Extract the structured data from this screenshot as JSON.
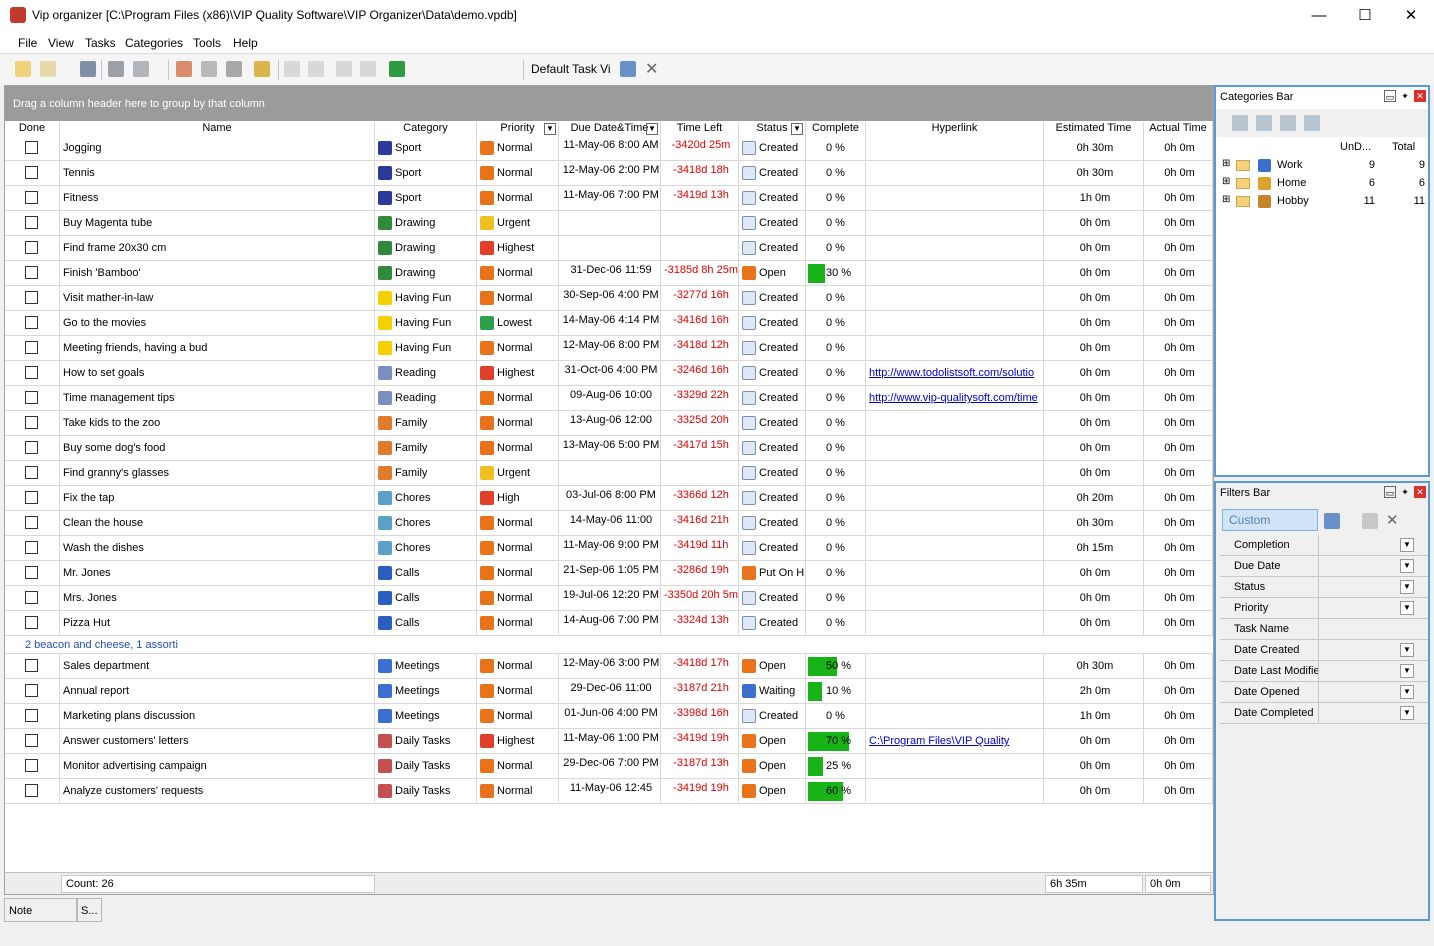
{
  "window": {
    "title": "Vip organizer [C:\\Program Files (x86)\\VIP Quality Software\\VIP Organizer\\Data\\demo.vpdb]",
    "minimize": "—",
    "maximize": "☐",
    "close": "✕"
  },
  "menu": [
    "File",
    "View",
    "Tasks",
    "Categories",
    "Tools",
    "Help"
  ],
  "toolbar": {
    "view_select": "Default Task Vi"
  },
  "grid": {
    "group_hint": "Drag a column header here to group by that column",
    "columns": [
      "Done",
      "Name",
      "Category",
      "Priority",
      "Due Date&Time",
      "Time Left",
      "Status",
      "Complete",
      "Hyperlink",
      "Estimated Time",
      "Actual Time"
    ],
    "rows": [
      {
        "name": "Jogging",
        "category": "Sport",
        "cat_icon": "flag-icon",
        "priority": "Normal",
        "pri_icon": "normal-icon",
        "due": "11-May-06 8:00 AM",
        "left": "-3420d 25m",
        "status": "Created",
        "st_icon": "doc-icon",
        "complete": "0 %",
        "pct": 0,
        "link": "",
        "est": "0h 30m",
        "act": "0h 0m"
      },
      {
        "name": "Tennis",
        "category": "Sport",
        "cat_icon": "flag-icon",
        "priority": "Normal",
        "pri_icon": "normal-icon",
        "due": "12-May-06 2:00 PM",
        "left": "-3418d 18h",
        "status": "Created",
        "st_icon": "doc-icon",
        "complete": "0 %",
        "pct": 0,
        "link": "",
        "est": "0h 30m",
        "act": "0h 0m"
      },
      {
        "name": "Fitness",
        "category": "Sport",
        "cat_icon": "flag-icon",
        "priority": "Normal",
        "pri_icon": "normal-icon",
        "due": "11-May-06 7:00 PM",
        "left": "-3419d 13h",
        "status": "Created",
        "st_icon": "doc-icon",
        "complete": "0 %",
        "pct": 0,
        "link": "",
        "est": "1h 0m",
        "act": "0h 0m"
      },
      {
        "name": "Buy Magenta tube",
        "category": "Drawing",
        "cat_icon": "picture-icon",
        "priority": "Urgent",
        "pri_icon": "warning-icon",
        "due": "",
        "left": "",
        "status": "Created",
        "st_icon": "doc-icon",
        "complete": "0 %",
        "pct": 0,
        "link": "",
        "est": "0h 0m",
        "act": "0h 0m"
      },
      {
        "name": "Find frame 20x30 cm",
        "category": "Drawing",
        "cat_icon": "picture-icon",
        "priority": "Highest",
        "pri_icon": "highest-icon",
        "due": "",
        "left": "",
        "status": "Created",
        "st_icon": "doc-icon",
        "complete": "0 %",
        "pct": 0,
        "link": "",
        "est": "0h 0m",
        "act": "0h 0m"
      },
      {
        "name": "Finish 'Bamboo'",
        "category": "Drawing",
        "cat_icon": "picture-icon",
        "priority": "Normal",
        "pri_icon": "normal-icon",
        "due": "31-Dec-06 11:59",
        "left": "-3185d 8h 25m",
        "status": "Open",
        "st_icon": "play-icon",
        "complete": "30 %",
        "pct": 30,
        "link": "",
        "est": "0h 0m",
        "act": "0h 0m"
      },
      {
        "name": "Visit mather-in-law",
        "category": "Having Fun",
        "cat_icon": "smiley-icon",
        "priority": "Normal",
        "pri_icon": "normal-icon",
        "due": "30-Sep-06 4:00 PM",
        "left": "-3277d 16h",
        "status": "Created",
        "st_icon": "doc-icon",
        "complete": "0 %",
        "pct": 0,
        "link": "",
        "est": "0h 0m",
        "act": "0h 0m"
      },
      {
        "name": "Go to the movies",
        "category": "Having Fun",
        "cat_icon": "smiley-icon",
        "priority": "Lowest",
        "pri_icon": "lowest-icon",
        "due": "14-May-06 4:14 PM",
        "left": "-3416d 16h",
        "status": "Created",
        "st_icon": "doc-icon",
        "complete": "0 %",
        "pct": 0,
        "link": "",
        "est": "0h 0m",
        "act": "0h 0m"
      },
      {
        "name": "Meeting friends, having a bud",
        "category": "Having Fun",
        "cat_icon": "smiley-icon",
        "priority": "Normal",
        "pri_icon": "normal-icon",
        "due": "12-May-06 8:00 PM",
        "left": "-3418d 12h",
        "status": "Created",
        "st_icon": "doc-icon",
        "complete": "0 %",
        "pct": 0,
        "link": "",
        "est": "0h 0m",
        "act": "0h 0m"
      },
      {
        "name": "How to set goals",
        "category": "Reading",
        "cat_icon": "book-icon",
        "priority": "Highest",
        "pri_icon": "highest-icon",
        "due": "31-Oct-06 4:00 PM",
        "left": "-3246d 16h",
        "status": "Created",
        "st_icon": "doc-icon",
        "complete": "0 %",
        "pct": 0,
        "link": "http://www.todolistsoft.com/solutio",
        "est": "0h 0m",
        "act": "0h 0m"
      },
      {
        "name": "Time management tips",
        "category": "Reading",
        "cat_icon": "book-icon",
        "priority": "Normal",
        "pri_icon": "normal-icon",
        "due": "09-Aug-06 10:00",
        "left": "-3329d 22h",
        "status": "Created",
        "st_icon": "doc-icon",
        "complete": "0 %",
        "pct": 0,
        "link": "http://www.vip-qualitysoft.com/time",
        "est": "0h 0m",
        "act": "0h 0m"
      },
      {
        "name": "Take kids to the zoo",
        "category": "Family",
        "cat_icon": "people-icon",
        "priority": "Normal",
        "pri_icon": "normal-icon",
        "due": "13-Aug-06 12:00",
        "left": "-3325d 20h",
        "status": "Created",
        "st_icon": "doc-icon",
        "complete": "0 %",
        "pct": 0,
        "link": "",
        "est": "0h 0m",
        "act": "0h 0m"
      },
      {
        "name": "Buy some dog's food",
        "category": "Family",
        "cat_icon": "people-icon",
        "priority": "Normal",
        "pri_icon": "normal-icon",
        "due": "13-May-06 5:00 PM",
        "left": "-3417d 15h",
        "status": "Created",
        "st_icon": "doc-icon",
        "complete": "0 %",
        "pct": 0,
        "link": "",
        "est": "0h 0m",
        "act": "0h 0m"
      },
      {
        "name": "Find granny's glasses",
        "category": "Family",
        "cat_icon": "people-icon",
        "priority": "Urgent",
        "pri_icon": "warning-icon",
        "due": "",
        "left": "",
        "status": "Created",
        "st_icon": "doc-icon",
        "complete": "0 %",
        "pct": 0,
        "link": "",
        "est": "0h 0m",
        "act": "0h 0m"
      },
      {
        "name": "Fix the tap",
        "category": "Chores",
        "cat_icon": "recycle-icon",
        "priority": "High",
        "pri_icon": "highest-icon",
        "due": "03-Jul-06 8:00 PM",
        "left": "-3366d 12h",
        "status": "Created",
        "st_icon": "doc-icon",
        "complete": "0 %",
        "pct": 0,
        "link": "",
        "est": "0h 20m",
        "act": "0h 0m"
      },
      {
        "name": "Clean the house",
        "category": "Chores",
        "cat_icon": "recycle-icon",
        "priority": "Normal",
        "pri_icon": "normal-icon",
        "due": "14-May-06 11:00",
        "left": "-3416d 21h",
        "status": "Created",
        "st_icon": "doc-icon",
        "complete": "0 %",
        "pct": 0,
        "link": "",
        "est": "0h 30m",
        "act": "0h 0m"
      },
      {
        "name": "Wash the dishes",
        "category": "Chores",
        "cat_icon": "recycle-icon",
        "priority": "Normal",
        "pri_icon": "normal-icon",
        "due": "11-May-06 9:00 PM",
        "left": "-3419d 11h",
        "status": "Created",
        "st_icon": "doc-icon",
        "complete": "0 %",
        "pct": 0,
        "link": "",
        "est": "0h 15m",
        "act": "0h 0m"
      },
      {
        "name": "Mr. Jones",
        "category": "Calls",
        "cat_icon": "phone-icon",
        "priority": "Normal",
        "pri_icon": "normal-icon",
        "due": "21-Sep-06 1:05 PM",
        "left": "-3286d 19h",
        "status": "Put On H",
        "st_icon": "pause-icon",
        "complete": "0 %",
        "pct": 0,
        "link": "",
        "est": "0h 0m",
        "act": "0h 0m"
      },
      {
        "name": "Mrs. Jones",
        "category": "Calls",
        "cat_icon": "phone-icon",
        "priority": "Normal",
        "pri_icon": "normal-icon",
        "due": "19-Jul-06 12:20 PM",
        "left": "-3350d 20h 5m",
        "status": "Created",
        "st_icon": "doc-icon",
        "complete": "0 %",
        "pct": 0,
        "link": "",
        "est": "0h 0m",
        "act": "0h 0m"
      },
      {
        "name": "Pizza Hut",
        "category": "Calls",
        "cat_icon": "phone-icon",
        "priority": "Normal",
        "pri_icon": "normal-icon",
        "due": "14-Aug-06 7:00 PM",
        "left": "-3324d 13h",
        "status": "Created",
        "st_icon": "doc-icon",
        "complete": "0 %",
        "pct": 0,
        "link": "",
        "est": "0h 0m",
        "act": "0h 0m"
      }
    ],
    "group_note": "2 beacon and cheese, 1 assorti",
    "rows2": [
      {
        "name": "Sales department",
        "category": "Meetings",
        "cat_icon": "clock-icon",
        "priority": "Normal",
        "pri_icon": "normal-icon",
        "due": "12-May-06 3:00 PM",
        "left": "-3418d 17h",
        "status": "Open",
        "st_icon": "play-icon",
        "complete": "50 %",
        "pct": 50,
        "link": "",
        "est": "0h 30m",
        "act": "0h 0m"
      },
      {
        "name": "Annual report",
        "category": "Meetings",
        "cat_icon": "clock-icon",
        "priority": "Normal",
        "pri_icon": "normal-icon",
        "due": "29-Dec-06 11:00",
        "left": "-3187d 21h",
        "status": "Waiting",
        "st_icon": "clock-icon",
        "complete": "10 %",
        "pct": 10,
        "link": "",
        "est": "2h 0m",
        "act": "0h 0m"
      },
      {
        "name": "Marketing plans discussion",
        "category": "Meetings",
        "cat_icon": "clock-icon",
        "priority": "Normal",
        "pri_icon": "normal-icon",
        "due": "01-Jun-06 4:00 PM",
        "left": "-3398d 16h",
        "status": "Created",
        "st_icon": "doc-icon",
        "complete": "0 %",
        "pct": 0,
        "link": "",
        "est": "1h 0m",
        "act": "0h 0m"
      },
      {
        "name": "Answer customers' letters",
        "category": "Daily Tasks",
        "cat_icon": "calendar-icon",
        "priority": "Highest",
        "pri_icon": "highest-icon",
        "due": "11-May-06 1:00 PM",
        "left": "-3419d 19h",
        "status": "Open",
        "st_icon": "play-icon",
        "complete": "70 %",
        "pct": 70,
        "link": "C:\\Program Files\\VIP Quality ",
        "est": "0h 0m",
        "act": "0h 0m"
      },
      {
        "name": "Monitor advertising campaign",
        "category": "Daily Tasks",
        "cat_icon": "calendar-icon",
        "priority": "Normal",
        "pri_icon": "normal-icon",
        "due": "29-Dec-06 7:00 PM",
        "left": "-3187d 13h",
        "status": "Open",
        "st_icon": "play-icon",
        "complete": "25 %",
        "pct": 25,
        "link": "",
        "est": "0h 0m",
        "act": "0h 0m"
      },
      {
        "name": "Analyze customers' requests",
        "category": "Daily Tasks",
        "cat_icon": "calendar-icon",
        "priority": "Normal",
        "pri_icon": "normal-icon",
        "due": "11-May-06 12:45",
        "left": "-3419d 19h",
        "status": "Open",
        "st_icon": "play-icon",
        "complete": "60 %",
        "pct": 60,
        "link": "",
        "est": "0h 0m",
        "act": "0h 0m"
      }
    ],
    "footer": {
      "count": "Count: 26",
      "est_total": "6h 35m",
      "act_total": "0h 0m"
    }
  },
  "statusbar": {
    "note": "Note",
    "s": "S..."
  },
  "categories_bar": {
    "title": "Categories Bar",
    "col_undone": "UnD...",
    "col_total": "Total",
    "items": [
      {
        "label": "Work",
        "undone": "9",
        "total": "9",
        "icon": "monitor-icon"
      },
      {
        "label": "Home",
        "undone": "6",
        "total": "6",
        "icon": "key-icon"
      },
      {
        "label": "Hobby",
        "undone": "11",
        "total": "11",
        "icon": "palette-icon"
      }
    ]
  },
  "filters_bar": {
    "title": "Filters Bar",
    "filter_select": "Custom",
    "fields": [
      "Completion",
      "Due Date",
      "Status",
      "Priority",
      "Task Name",
      "Date Created",
      "Date Last Modifie",
      "Date Opened",
      "Date Completed"
    ]
  },
  "colors": {
    "accent": "#5b9bd5",
    "progress": "#17b317",
    "overdue": "#e00000",
    "link": "#0000cc"
  }
}
